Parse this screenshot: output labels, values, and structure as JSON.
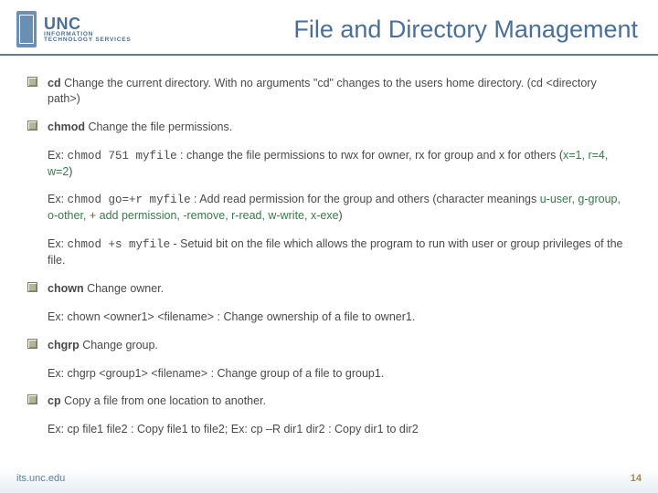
{
  "header": {
    "logo_main": "UNC",
    "logo_line1": "INFORMATION",
    "logo_line2": "TECHNOLOGY SERVICES",
    "title": "File and Directory Management"
  },
  "items": [
    {
      "cmd": "cd",
      "desc": " Change the current directory. With no arguments \"cd\" changes to the users home directory. (cd <directory path>)"
    },
    {
      "cmd": "chmod",
      "desc": " Change the file permissions."
    }
  ],
  "chmod_ex1_pre": "Ex: ",
  "chmod_ex1_mono": "chmod 751 myfile",
  "chmod_ex1_post": " : change the file permissions to rwx for owner, rx for group and x for others (",
  "chmod_ex1_green": "x=1, r=4, w=2",
  "chmod_ex1_close": ")",
  "chmod_ex2_pre": "Ex: ",
  "chmod_ex2_mono": "chmod go=+r myfile",
  "chmod_ex2_post": " : Add read permission for the group and others (character meanings ",
  "chmod_ex2_green": "u-user, g-group, o-other, + add permission, -remove, r-read, w-write, x-exe",
  "chmod_ex2_close": ")",
  "chmod_ex3_pre": "Ex: ",
  "chmod_ex3_mono": "chmod +s myfile",
  "chmod_ex3_post": " - Setuid bit on the file which allows the program to run with user or group privileges of the file.",
  "chown": {
    "cmd": "chown",
    "desc": " Change owner."
  },
  "chown_ex": "Ex: chown <owner1> <filename> : Change ownership of a file to owner1.",
  "chgrp": {
    "cmd": "chgrp",
    "desc": " Change group."
  },
  "chgrp_ex": "Ex: chgrp <group1> <filename> : Change group of a file to group1.",
  "cp": {
    "cmd": "cp",
    "desc": " Copy a file from one location to another."
  },
  "cp_ex": "Ex: cp file1 file2 : Copy file1 to file2;     Ex: cp –R dir1 dir2 : Copy dir1 to dir2",
  "footer": {
    "url": "its.unc.edu",
    "page": "14"
  }
}
